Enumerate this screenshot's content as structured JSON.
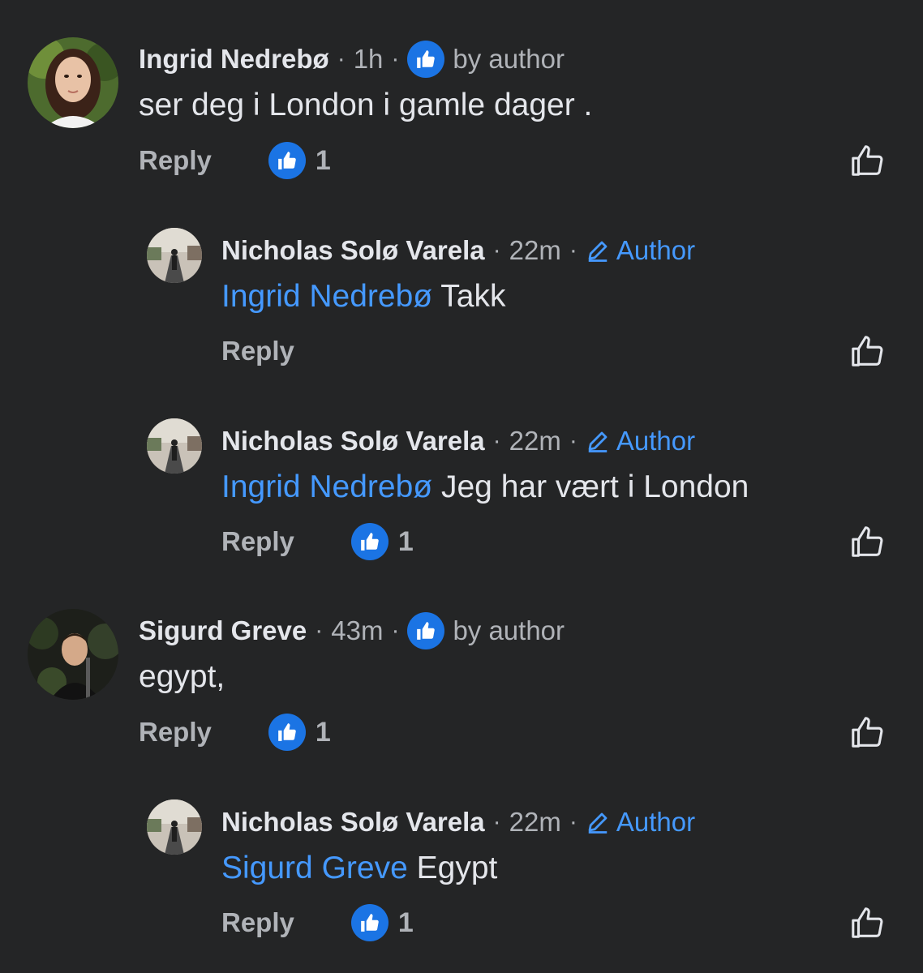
{
  "comments": [
    {
      "author": "Ingrid Nedrebø",
      "time": "1h",
      "badge": "by author",
      "text": "ser deg i London i gamle dager .",
      "reply_label": "Reply",
      "reaction_count": "1"
    },
    {
      "author": "Nicholas Solø Varela",
      "time": "22m",
      "badge": "Author",
      "mention": "Ingrid Nedrebø",
      "text": " Takk",
      "reply_label": "Reply"
    },
    {
      "author": "Nicholas Solø Varela",
      "time": "22m",
      "badge": "Author",
      "mention": "Ingrid Nedrebø",
      "text": " Jeg har vært i London",
      "reply_label": "Reply",
      "reaction_count": "1"
    },
    {
      "author": "Sigurd Greve",
      "time": "43m",
      "badge": "by author",
      "text": "egypt,",
      "reply_label": "Reply",
      "reaction_count": "1"
    },
    {
      "author": "Nicholas Solø Varela",
      "time": "22m",
      "badge": "Author",
      "mention": "Sigurd Greve",
      "text": " Egypt",
      "reply_label": "Reply",
      "reaction_count": "1"
    }
  ],
  "separator": "·",
  "colors": {
    "background": "#242526",
    "text": "#e4e6eb",
    "secondary": "#b0b3b8",
    "accent": "#4599ff",
    "like_badge": "#1b74e4"
  },
  "icons": {
    "like_badge": "thumbs-up-icon",
    "author_tag": "pencil-icon",
    "like_button": "thumbs-up-outline-icon"
  }
}
